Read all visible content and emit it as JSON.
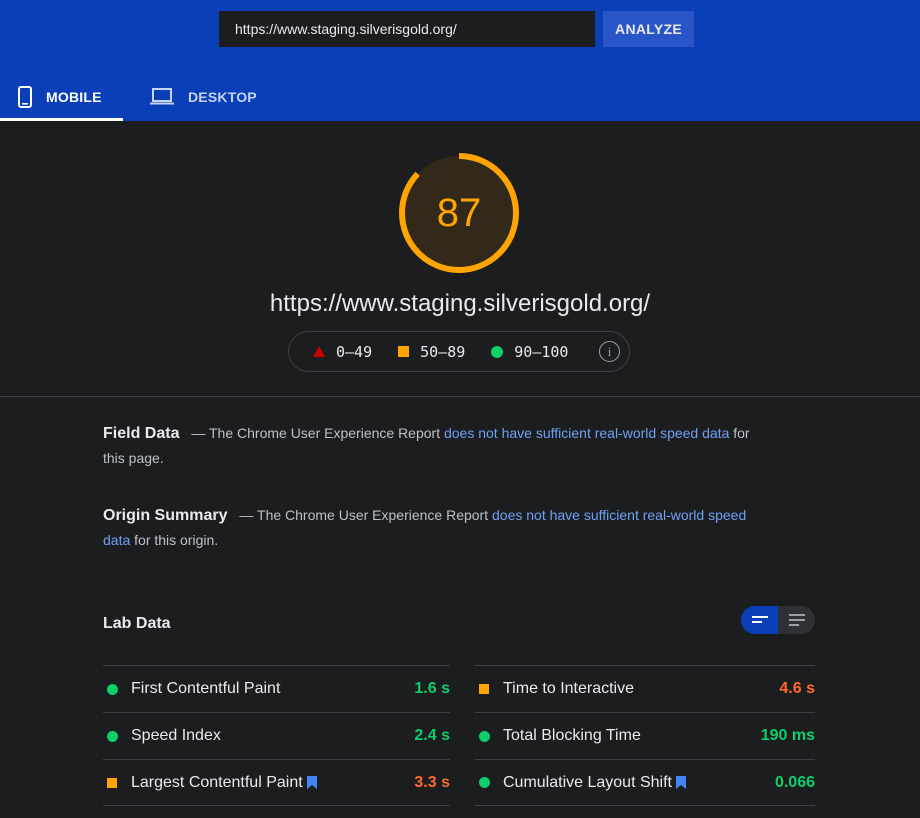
{
  "search": {
    "url_value": "https://www.staging.silverisgold.org/",
    "analyze_label": "ANALYZE"
  },
  "tabs": [
    {
      "label": "MOBILE",
      "icon": "smartphone-icon",
      "active": true
    },
    {
      "label": "DESKTOP",
      "icon": "laptop-icon",
      "active": false
    }
  ],
  "report": {
    "score": "87",
    "score_fraction": 0.87,
    "score_color": "#ffa400",
    "page_url": "https://www.staging.silverisgold.org/",
    "legend": [
      {
        "range": "0–49",
        "icon": "triangle-icon",
        "color": "#c00"
      },
      {
        "range": "50–89",
        "icon": "square-icon",
        "color": "#ffa400"
      },
      {
        "range": "90–100",
        "icon": "circle-icon",
        "color": "#0cce6b"
      }
    ],
    "info_glyph": "i"
  },
  "field_data": {
    "title": "Field Data",
    "text_before": "— The Chrome User Experience Report ",
    "link": "does not have sufficient real-world speed data",
    "text_after": " for this page."
  },
  "origin_summary": {
    "title": "Origin Summary",
    "text_before": "— The Chrome User Experience Report ",
    "link": "does not have sufficient real-world speed data",
    "text_after": " for this origin."
  },
  "lab_data": {
    "title": "Lab Data",
    "view_toggle": [
      "compact-view-icon",
      "expanded-view-icon"
    ],
    "left_metrics": [
      {
        "name": "First Contentful Paint",
        "value": "1.6 s",
        "rating": "good",
        "bookmark": false
      },
      {
        "name": "Speed Index",
        "value": "2.4 s",
        "rating": "good",
        "bookmark": false
      },
      {
        "name": "Largest Contentful Paint",
        "value": "3.3 s",
        "rating": "average",
        "bookmark": true
      }
    ],
    "right_metrics": [
      {
        "name": "Time to Interactive",
        "value": "4.6 s",
        "rating": "average",
        "bookmark": false
      },
      {
        "name": "Total Blocking Time",
        "value": "190 ms",
        "rating": "good",
        "bookmark": false
      },
      {
        "name": "Cumulative Layout Shift",
        "value": "0.066",
        "rating": "good",
        "bookmark": true
      }
    ]
  },
  "colors": {
    "header": "#0b3fb8",
    "background": "#1c1d1f",
    "good": "#0cce6b",
    "average": "#ffa400",
    "poor": "#c00",
    "link": "#6fa0f5"
  }
}
